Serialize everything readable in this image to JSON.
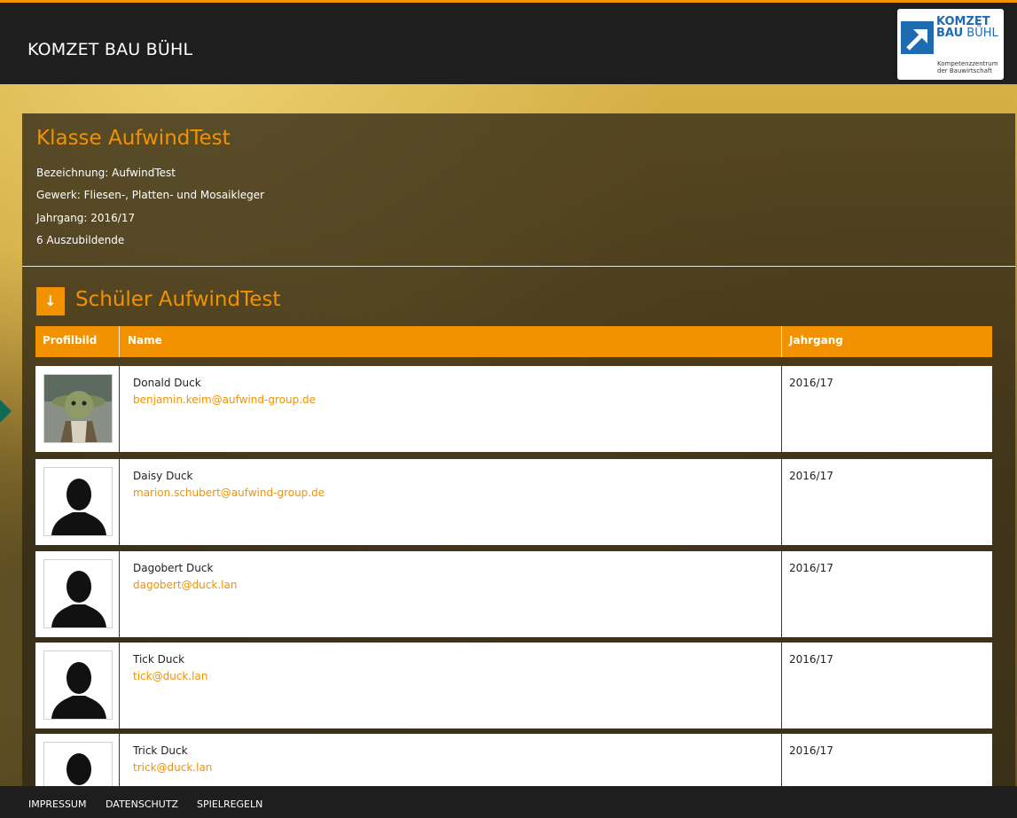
{
  "site": {
    "title": "KOMZET BAU BÜHL",
    "logo": {
      "line1": "KOMZET",
      "line2_bold": "BAU",
      "line2_rest": "BÜHL",
      "sub1": "Kompetenzzentrum",
      "sub2": "der Bauwirtschaft"
    }
  },
  "class_info": {
    "title": "Klasse AufwindTest",
    "bezeichnung": "Bezeichnung: AufwindTest",
    "gewerk": "Gewerk: Fliesen-, Platten- und Mosaikleger",
    "jahrgang": "Jahrgang: 2016/17",
    "count": "6 Auszubildende"
  },
  "students_section": {
    "icon": "arrow-down-icon",
    "title": "Schüler AufwindTest",
    "headers": {
      "profilbild": "Profilbild",
      "name": "Name",
      "jahrgang": "Jahrgang"
    },
    "rows": [
      {
        "name": "Donald Duck",
        "email": "benjamin.keim@aufwind-group.de",
        "year": "2016/17",
        "avatar": "yoda-photo"
      },
      {
        "name": "Daisy Duck",
        "email": "marion.schubert@aufwind-group.de",
        "year": "2016/17",
        "avatar": "silhouette-icon"
      },
      {
        "name": "Dagobert Duck",
        "email": "dagobert@duck.lan",
        "year": "2016/17",
        "avatar": "silhouette-icon"
      },
      {
        "name": "Tick Duck",
        "email": "tick@duck.lan",
        "year": "2016/17",
        "avatar": "silhouette-icon"
      },
      {
        "name": "Trick Duck",
        "email": "trick@duck.lan",
        "year": "2016/17",
        "avatar": "silhouette-icon"
      }
    ]
  },
  "footer": {
    "links": [
      "IMPRESSUM",
      "DATENSCHUTZ",
      "SPIELREGELN"
    ]
  },
  "colors": {
    "accent": "#f39200",
    "header": "#1e1e1e",
    "logo_blue": "#1f6bb0"
  }
}
